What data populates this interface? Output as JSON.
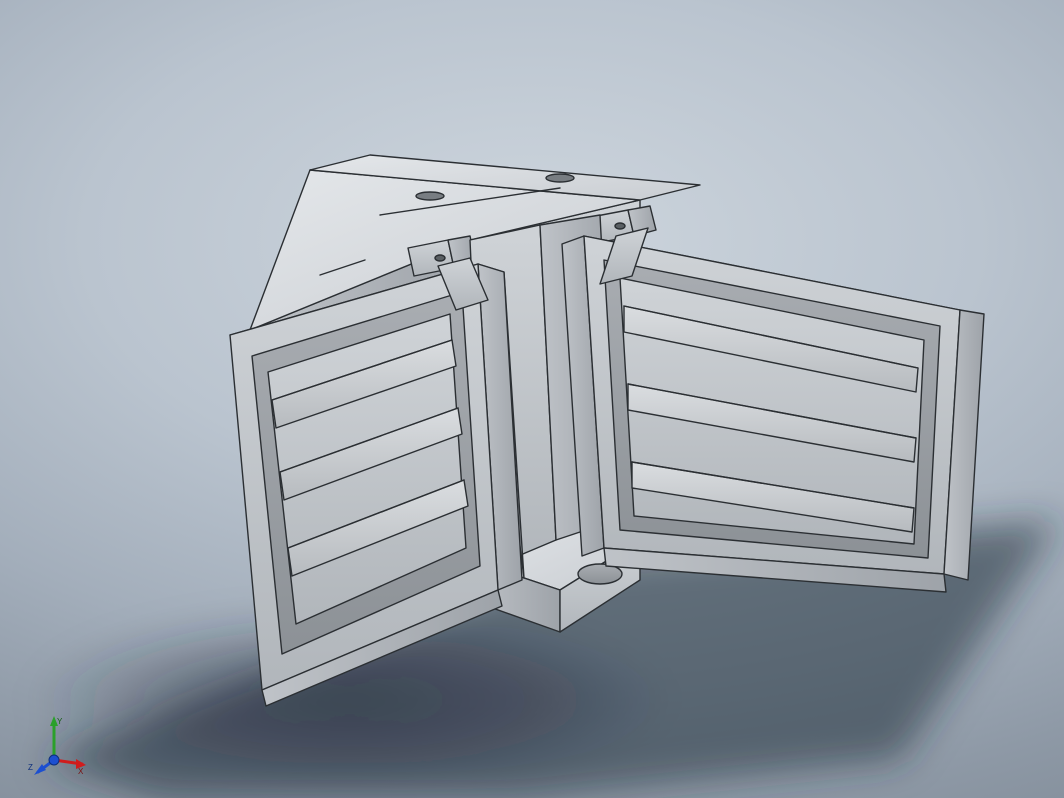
{
  "app": {
    "type": "CAD 3D Viewport",
    "title": ""
  },
  "triad": {
    "axes": {
      "x": {
        "label": "X",
        "color": "#d01c1c"
      },
      "y": {
        "label": "Y",
        "color": "#2aa02a"
      },
      "z": {
        "label": "Z",
        "color": "#1c4fd0"
      }
    },
    "origin_color": "#1c4fd0"
  },
  "render": {
    "background_gradient": [
      "#cdd5dd",
      "#8e99a6"
    ],
    "floor_shadow": true
  },
  "model": {
    "description": "Clamp / bale-grab style forklift attachment — central carriage block with two large rectangular clamp pads (each with three horizontal reinforcing ribs) on hinged arms, shown opened.",
    "material": "Plain grey (default CAD material)",
    "parts": [
      {
        "name": "carriage-block",
        "qty": 1
      },
      {
        "name": "hinge-lug-top",
        "qty": 4
      },
      {
        "name": "clamp-arm-left",
        "qty": 1
      },
      {
        "name": "clamp-arm-right",
        "qty": 1
      },
      {
        "name": "clamp-pad-left",
        "qty": 1,
        "ribs": 3
      },
      {
        "name": "clamp-pad-right",
        "qty": 1,
        "ribs": 3
      },
      {
        "name": "lower-link",
        "qty": 1
      }
    ]
  }
}
